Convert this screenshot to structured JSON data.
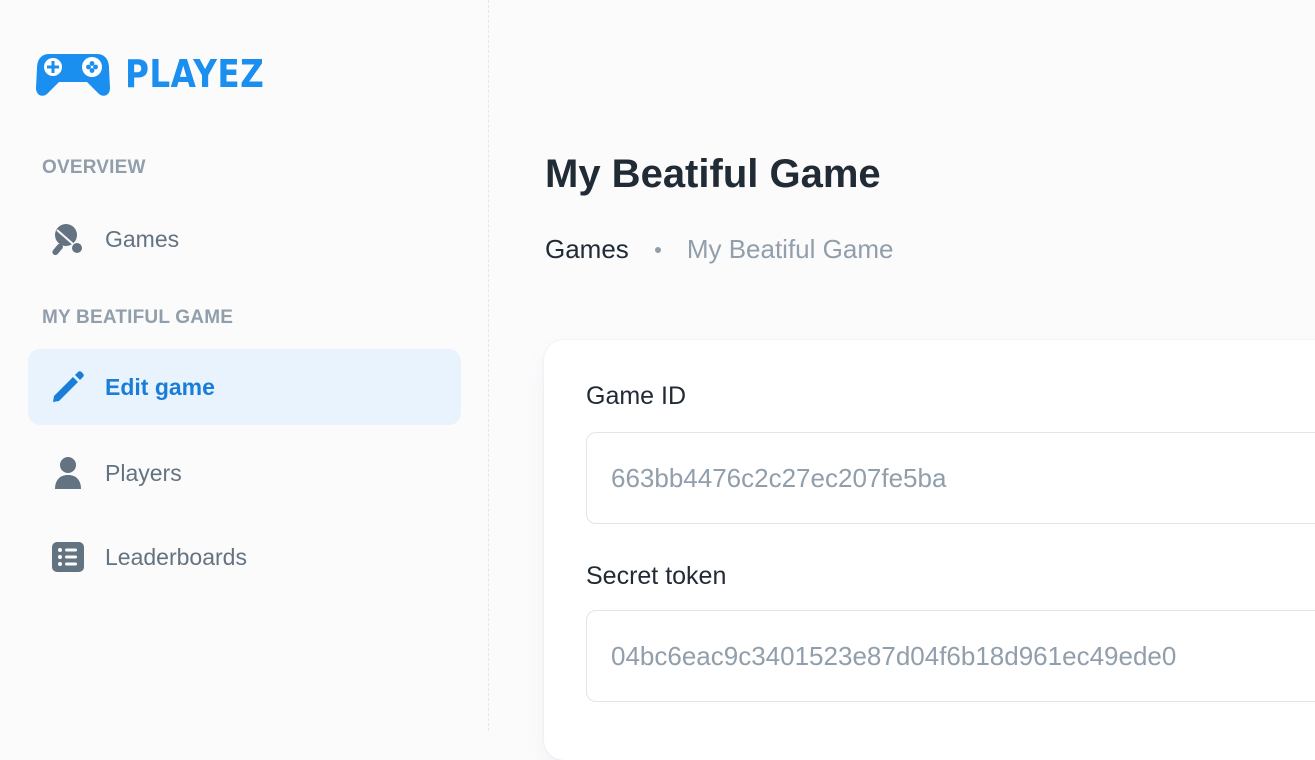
{
  "brand": {
    "name": "PLAYEZ",
    "logo_icon": "gamepad-icon",
    "color": "#1a8ff0"
  },
  "sidebar": {
    "sections": [
      {
        "title": "OVERVIEW",
        "items": [
          {
            "label": "Games",
            "icon": "ping-pong-icon",
            "active": false
          }
        ]
      },
      {
        "title": "MY BEATIFUL GAME",
        "items": [
          {
            "label": "Edit game",
            "icon": "pencil-icon",
            "active": true
          },
          {
            "label": "Players",
            "icon": "user-icon",
            "active": false
          },
          {
            "label": "Leaderboards",
            "icon": "list-icon",
            "active": false
          }
        ]
      }
    ]
  },
  "page": {
    "title": "My Beatiful Game",
    "breadcrumb": {
      "link": "Games",
      "current": "My Beatiful Game"
    }
  },
  "form": {
    "game_id": {
      "label": "Game ID",
      "value": "663bb4476c2c27ec207fe5ba"
    },
    "secret_token": {
      "label": "Secret token",
      "value": "04bc6eac9c3401523e87d04f6b18d961ec49ede0"
    }
  },
  "colors": {
    "accent": "#1a7ed8",
    "active_bg": "#e9f3fd",
    "muted": "#919eab",
    "text": "#212b36",
    "icon": "#637381"
  }
}
